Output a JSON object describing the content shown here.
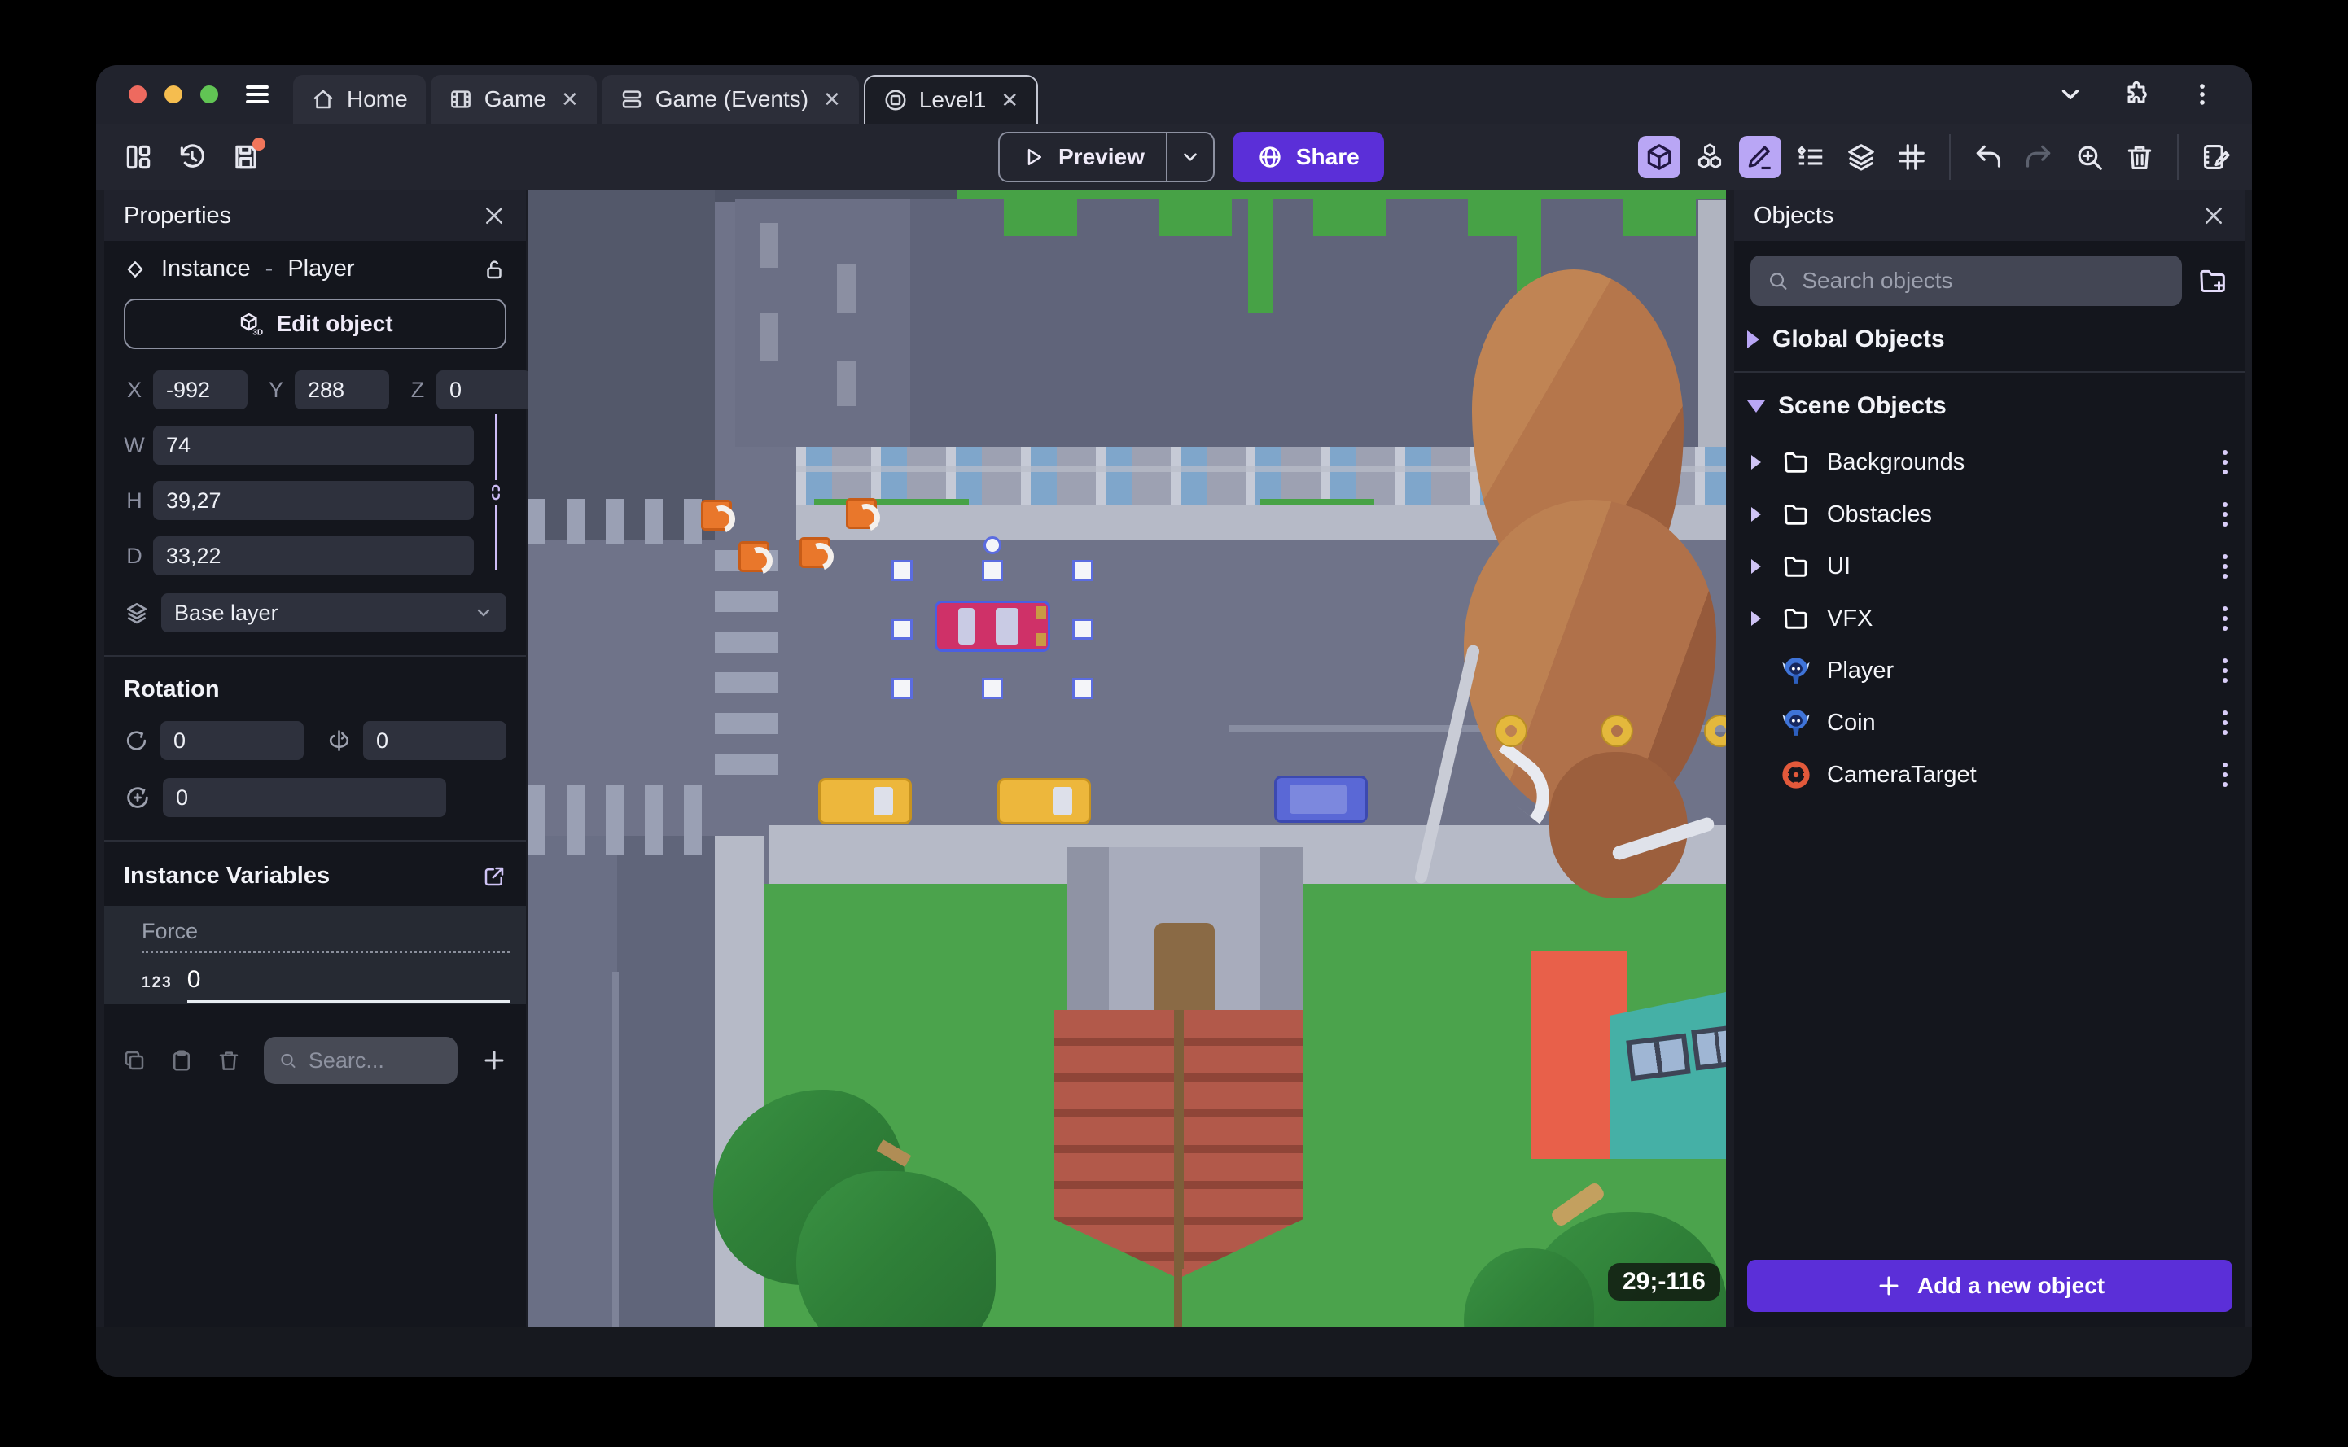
{
  "colors": {
    "accent": "#5b2fd8",
    "toggle_active": "#b9a6f5",
    "unsaved_dot": "#f1765b"
  },
  "titlebar": {
    "traffic_lights": [
      "#ee6a5f",
      "#f5bd4f",
      "#61c454"
    ],
    "tabs": [
      {
        "label": "Home",
        "icon": "home-icon",
        "active": false
      },
      {
        "label": "Game",
        "icon": "film-icon",
        "active": false
      },
      {
        "label": "Game (Events)",
        "icon": "events-icon",
        "active": false
      },
      {
        "label": "Level1",
        "icon": "scene-icon",
        "active": true
      }
    ]
  },
  "toolbar": {
    "preview_label": "Preview",
    "share_label": "Share"
  },
  "properties": {
    "title": "Properties",
    "instance_label": "Instance",
    "separator": "-",
    "object_name": "Player",
    "edit_object_label": "Edit object",
    "x_label": "X",
    "x_value": "-992",
    "y_label": "Y",
    "y_value": "288",
    "z_label": "Z",
    "z_value": "0",
    "w_label": "W",
    "w_value": "74",
    "h_label": "H",
    "h_value": "39,27",
    "d_label": "D",
    "d_value": "33,22",
    "layer_value": "Base layer",
    "rotation_title": "Rotation",
    "rot_x": "0",
    "rot_y": "0",
    "rot_z": "0",
    "variables_title": "Instance Variables",
    "variable_name": "Force",
    "variable_type": "123",
    "variable_value": "0",
    "search_placeholder": "Searc..."
  },
  "objects": {
    "title": "Objects",
    "search_placeholder": "Search objects",
    "global_group": "Global Objects",
    "scene_group": "Scene Objects",
    "items": [
      {
        "label": "Backgrounds",
        "type": "folder"
      },
      {
        "label": "Obstacles",
        "type": "folder"
      },
      {
        "label": "UI",
        "type": "folder"
      },
      {
        "label": "VFX",
        "type": "folder"
      },
      {
        "label": "Player",
        "type": "object-3d"
      },
      {
        "label": "Coin",
        "type": "object-3d"
      },
      {
        "label": "CameraTarget",
        "type": "camera-target"
      }
    ],
    "add_button_label": "Add a new object"
  },
  "canvas": {
    "coords_badge": "29;-116"
  }
}
